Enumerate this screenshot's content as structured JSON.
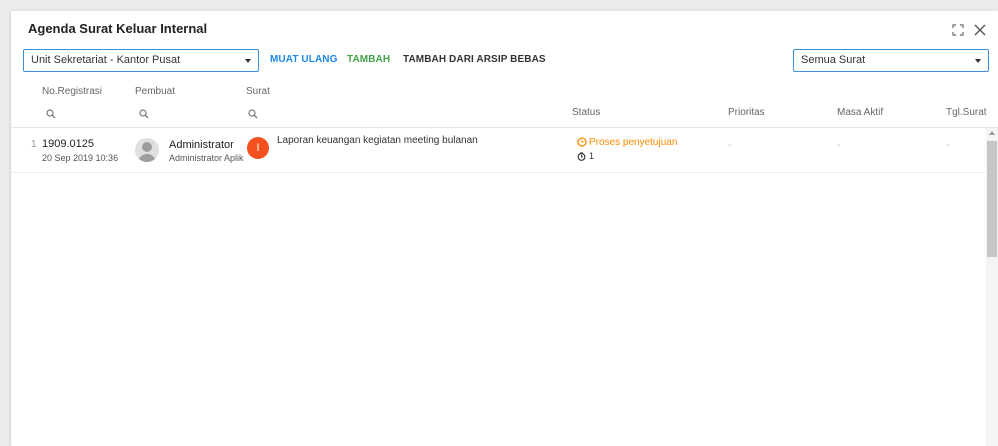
{
  "dialog": {
    "title": "Agenda Surat Keluar Internal"
  },
  "toolbar": {
    "unit_value": "Unit Sekretariat - Kantor Pusat",
    "reload_label": "MUAT ULANG",
    "add_label": "TAMBAH",
    "add_archive_label": "TAMBAH DARI ARSIP BEBAS",
    "filter_value": "Semua Surat"
  },
  "columns": {
    "no_registrasi": "No.Registrasi",
    "pembuat": "Pembuat",
    "surat": "Surat",
    "status": "Status",
    "prioritas": "Prioritas",
    "masa_aktif": "Masa Aktif",
    "tgl_surat": "Tgl.Surat"
  },
  "rows": [
    {
      "index": "1",
      "reg_no": "1909.0125",
      "date": "20 Sep 2019 10:36",
      "creator_name": "Administrator",
      "creator_role": "Administrator Aplik",
      "badge": "I",
      "subject": "Laporan keuangan kegiatan meeting bulanan",
      "status": "Proses penyetujuan",
      "status_count": "1",
      "prioritas": "-",
      "masa_aktif": "-",
      "tgl_surat": "-"
    }
  ],
  "colors": {
    "accent_blue": "#1e88e5",
    "accent_green": "#43a047",
    "status_orange": "#fb8c00",
    "badge_red": "#f4511e"
  },
  "icons": [
    "maximize-icon",
    "close-icon",
    "search-icon",
    "clock-icon",
    "timer-icon",
    "avatar-icon"
  ]
}
